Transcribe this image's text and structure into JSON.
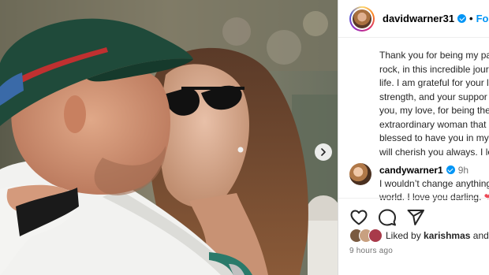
{
  "post": {
    "author": "davidwarner31",
    "separator": "•",
    "follow_label": "Follow",
    "caption_lines": [
      "Thank you for being my pa",
      "rock, in this incredible jour",
      "life. I am grateful for your l",
      "strength, and your suppor",
      "you, my love, for being the",
      "extraordinary woman that",
      "blessed to have you in my",
      "will cherish you always. I lo"
    ],
    "time_ago": "9 hours ago"
  },
  "comment": {
    "user": "candywarner1",
    "time": "9h",
    "lines": [
      "I wouldn’t change anything",
      "world. I love you darling."
    ],
    "heart": "❤"
  },
  "likes": {
    "prefix": "Liked by",
    "user": "karishmas",
    "suffix": "and"
  },
  "icons": {
    "like": "heart-outline-icon",
    "comment": "comment-bubble-icon",
    "share": "paper-plane-icon",
    "next": "chevron-right-icon",
    "verified": "verified-badge-icon"
  },
  "colors": {
    "link": "#0095f6",
    "secondary_text": "#737373",
    "heart": "#ed4956"
  }
}
